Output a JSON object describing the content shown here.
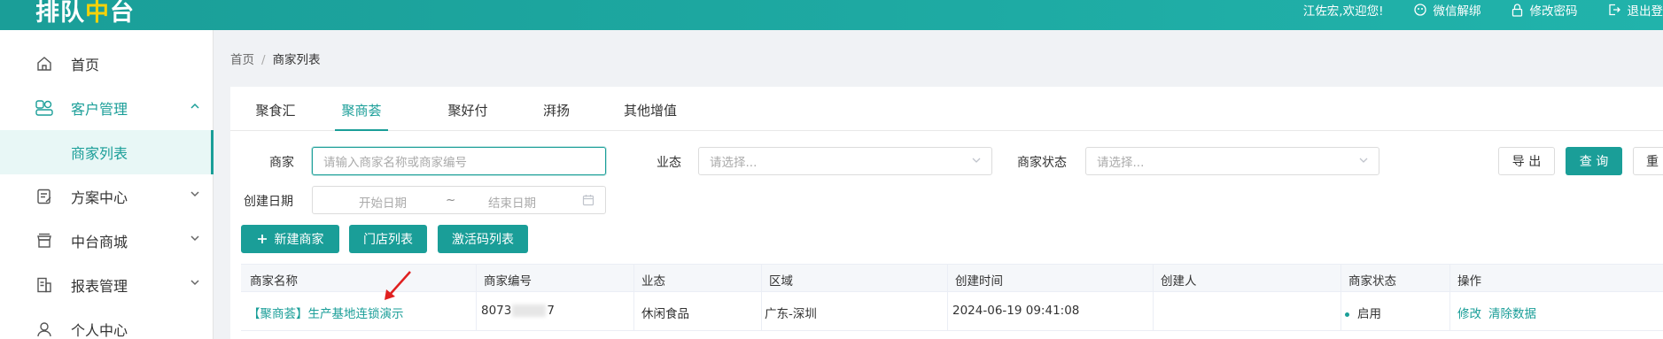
{
  "header": {
    "logo": {
      "part1": "排队",
      "part2": "中",
      "part3": "台"
    },
    "welcome": "江佐宏,欢迎您!",
    "wechat_unbind": "微信解绑",
    "change_password": "修改密码",
    "logout": "退出登"
  },
  "sidebar": {
    "items": [
      {
        "label": "首页",
        "icon": "home-icon"
      },
      {
        "label": "客户管理",
        "icon": "customers-icon"
      },
      {
        "label": "商家列表"
      },
      {
        "label": "方案中心",
        "icon": "plan-icon"
      },
      {
        "label": "中台商城",
        "icon": "store-icon"
      },
      {
        "label": "报表管理",
        "icon": "report-icon"
      },
      {
        "label": "个人中心",
        "icon": "user-icon"
      }
    ]
  },
  "breadcrumb": {
    "home": "首页",
    "sep": "/",
    "current": "商家列表"
  },
  "tabs": [
    "聚食汇",
    "聚商荟",
    "聚好付",
    "湃扬",
    "其他增值"
  ],
  "filters": {
    "merchant_label": "商家",
    "merchant_placeholder": "请输入商家名称或商家编号",
    "business_label": "业态",
    "business_placeholder": "请选择...",
    "status_label": "商家状态",
    "status_placeholder": "请选择...",
    "created_label": "创建日期",
    "start_date": "开始日期",
    "tilde": "~",
    "end_date": "结束日期"
  },
  "buttons": {
    "export": "导 出",
    "query": "查 询",
    "reset": "重",
    "new_merchant": "新建商家",
    "store_list": "门店列表",
    "activation_list": "激活码列表"
  },
  "table": {
    "headers": [
      "商家名称",
      "商家编号",
      "业态",
      "区域",
      "创建时间",
      "创建人",
      "商家状态",
      "操作"
    ],
    "rows": [
      {
        "name": "【聚商荟】生产基地连锁演示",
        "id_prefix": "8073",
        "id_suffix": "7",
        "business": "休闲食品",
        "region": "广东-深圳",
        "created": "2024-06-19 09:41:08",
        "creator": "",
        "status": "启用",
        "ops": [
          "修改",
          "清除数据"
        ]
      }
    ]
  },
  "colors": {
    "brand": "#1a9e98",
    "logo_accent": "#f4d20a",
    "annotation_arrow": "#e02020"
  }
}
